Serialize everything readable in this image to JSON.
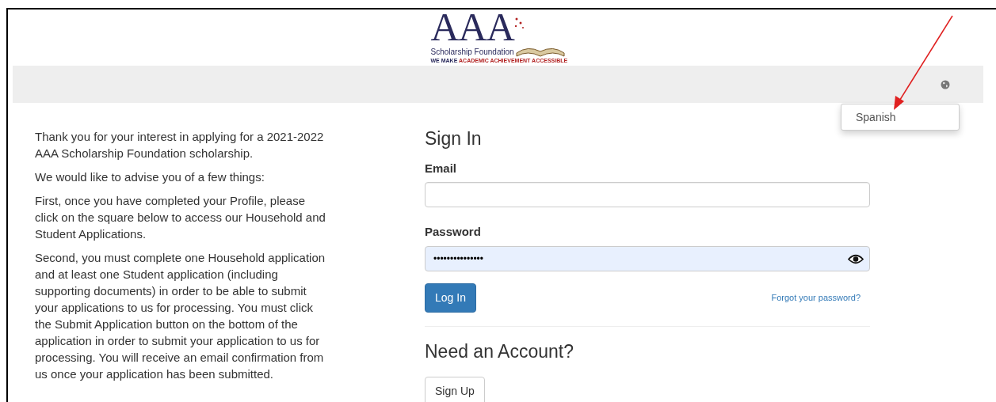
{
  "logo": {
    "letters": "AAA",
    "name": "Scholarship Foundation",
    "tagline_lead": "WE MAKE",
    "tagline_emphasis": "ACADEMIC ACHIEVEMENT ACCESSIBLE"
  },
  "language_menu": {
    "expanded": true,
    "items": [
      {
        "label": "Spanish"
      }
    ]
  },
  "intro": [
    "Thank you for your interest in applying for a 2021-2022 AAA Scholarship Foundation scholarship.",
    "We would like to advise you of a few things:",
    "First, once you have completed your Profile, please click on the square below to access our Household and Student Applications.",
    "Second, you must complete one Household application and at least one Student application (including supporting documents) in order to be able to submit your applications to us for processing. You must click the Submit Application button on the bottom of the application in order to submit your application to us for processing. You will receive an email confirmation from us once your application has been submitted."
  ],
  "sign_in": {
    "title": "Sign In",
    "email_label": "Email",
    "password_label": "Password",
    "password_value": "•••••••••••••••",
    "login_button": "Log In",
    "forgot_link": "Forgot your password?"
  },
  "account": {
    "title": "Need an Account?",
    "signup_button": "Sign Up"
  }
}
